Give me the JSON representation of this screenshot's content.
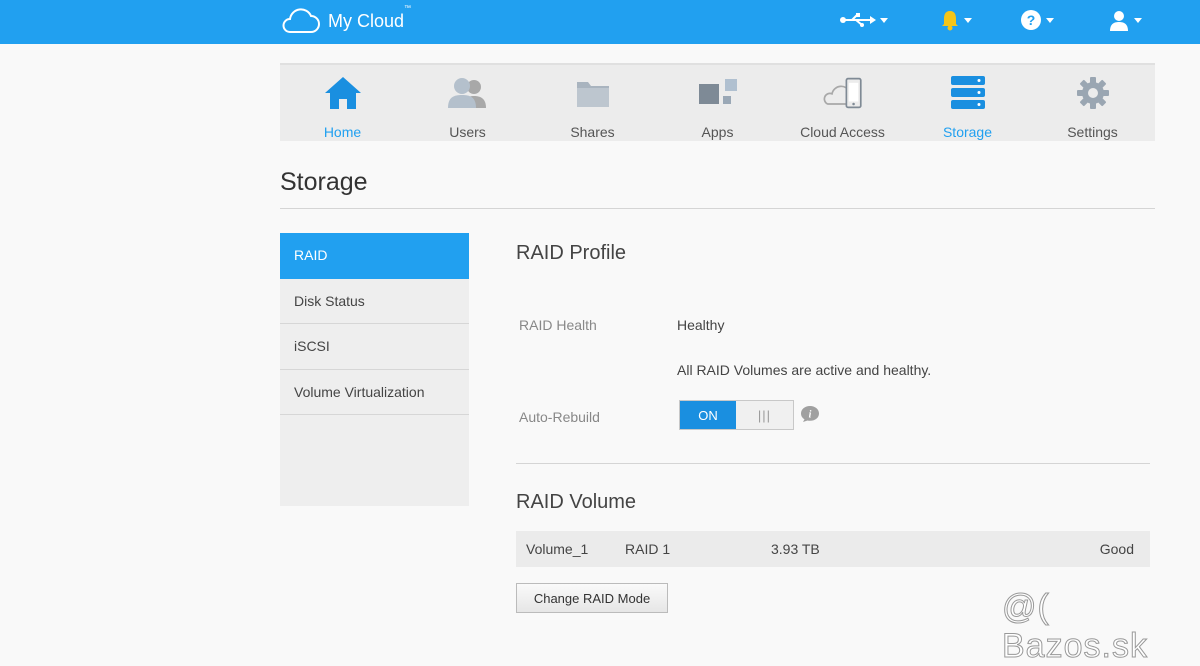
{
  "header": {
    "brand": "My Cloud",
    "brand_tm": "™",
    "icons": [
      "usb-icon",
      "bell-icon",
      "help-icon",
      "user-icon"
    ],
    "colors": {
      "bar": "#21a0f0",
      "bell": "#f5c518"
    }
  },
  "nav": {
    "items": [
      {
        "label": "Home",
        "icon": "home-icon",
        "active": true
      },
      {
        "label": "Users",
        "icon": "users-icon",
        "active": false
      },
      {
        "label": "Shares",
        "icon": "folder-icon",
        "active": false
      },
      {
        "label": "Apps",
        "icon": "apps-icon",
        "active": false
      },
      {
        "label": "Cloud Access",
        "icon": "cloud-access-icon",
        "active": false
      },
      {
        "label": "Storage",
        "icon": "storage-icon",
        "active": true
      },
      {
        "label": "Settings",
        "icon": "gear-icon",
        "active": false
      }
    ]
  },
  "page": {
    "title": "Storage"
  },
  "sidebar": {
    "items": [
      {
        "label": "RAID",
        "active": true
      },
      {
        "label": "Disk Status",
        "active": false
      },
      {
        "label": "iSCSI",
        "active": false
      },
      {
        "label": "Volume Virtualization",
        "active": false
      }
    ]
  },
  "raid_profile": {
    "title": "RAID Profile",
    "health_label": "RAID Health",
    "health_value": "Healthy",
    "health_detail": "All RAID Volumes are active and healthy.",
    "auto_rebuild_label": "Auto-Rebuild",
    "toggle_on": "ON",
    "toggle_off": "|||"
  },
  "raid_volume": {
    "title": "RAID Volume",
    "rows": [
      {
        "name": "Volume_1",
        "mode": "RAID 1",
        "size": "3.93 TB",
        "status": "Good"
      }
    ],
    "change_button": "Change RAID Mode"
  },
  "watermark": "@( Bazos.sk"
}
